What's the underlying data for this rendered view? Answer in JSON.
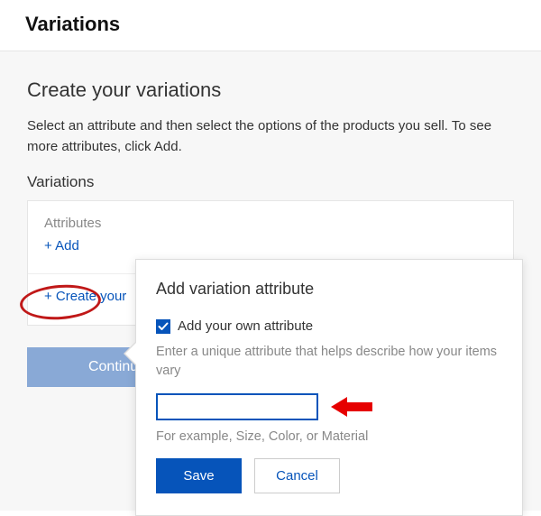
{
  "header": {
    "title": "Variations"
  },
  "main": {
    "subtitle": "Create your variations",
    "description": "Select an attribute and then select the options of the products you sell. To see more attributes, click Add.",
    "section_label": "Variations",
    "card": {
      "attributes_title": "Attributes",
      "add_link": "+ Add",
      "create_link": "+ Create your"
    },
    "continue_label": "Continue"
  },
  "popover": {
    "title": "Add variation attribute",
    "checkbox_label": "Add your own attribute",
    "helper": "Enter a unique attribute that helps describe how your items vary",
    "input_value": "",
    "example": "For example, Size, Color, or Material",
    "save_label": "Save",
    "cancel_label": "Cancel"
  },
  "annotations": {
    "ellipse": "highlight-add-link",
    "arrow": "point-to-input"
  }
}
